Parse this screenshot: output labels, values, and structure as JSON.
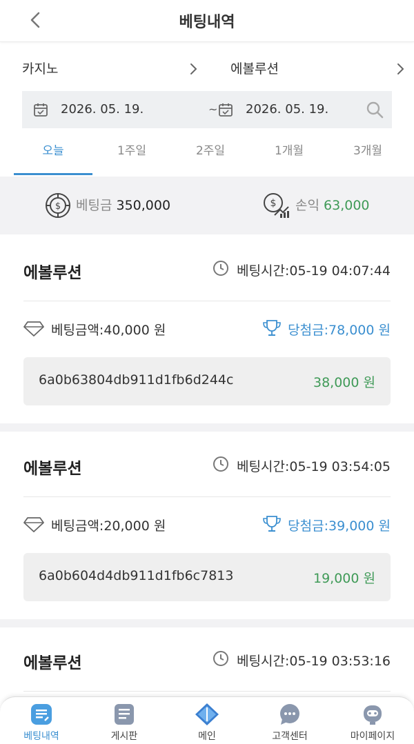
{
  "header": {
    "title": "베팅내역"
  },
  "filters": {
    "category": "카지노",
    "game": "에볼루션"
  },
  "date_range": {
    "from": "2026. 05. 19.",
    "separator": "~",
    "to": "2026. 05. 19."
  },
  "tabs": [
    {
      "label": "오늘",
      "active": true
    },
    {
      "label": "1주일",
      "active": false
    },
    {
      "label": "2주일",
      "active": false
    },
    {
      "label": "1개월",
      "active": false
    },
    {
      "label": "3개월",
      "active": false
    }
  ],
  "summary": {
    "bet_label": "베팅금",
    "bet_value": "350,000",
    "profit_label": "손익",
    "profit_value": "63,000"
  },
  "bets": [
    {
      "game": "에볼루션",
      "time": "베팅시간:05-19 04:07:44",
      "bet_amount": "베팅금액:40,000 원",
      "win_amount": "당첨금:78,000 원",
      "id": "6a0b63804db911d1fb6d244c",
      "profit": "38,000 원"
    },
    {
      "game": "에볼루션",
      "time": "베팅시간:05-19 03:54:05",
      "bet_amount": "베팅금액:20,000 원",
      "win_amount": "당첨금:39,000 원",
      "id": "6a0b604d4db911d1fb6c7813",
      "profit": "19,000 원"
    },
    {
      "game": "에볼루션",
      "time": "베팅시간:05-19 03:53:16"
    }
  ],
  "bottom_nav": [
    {
      "label": "베팅내역",
      "icon": "betting-history-icon",
      "active": true
    },
    {
      "label": "게시판",
      "icon": "board-icon",
      "active": false
    },
    {
      "label": "메인",
      "icon": "main-diamond-icon",
      "active": false
    },
    {
      "label": "고객센터",
      "icon": "chat-bubble-icon",
      "active": false
    },
    {
      "label": "마이페이지",
      "icon": "robot-avatar-icon",
      "active": false
    }
  ],
  "colors": {
    "accent": "#3b8fd0",
    "profit_green": "#3f9a57",
    "panel_gray": "#f2f2f4"
  }
}
